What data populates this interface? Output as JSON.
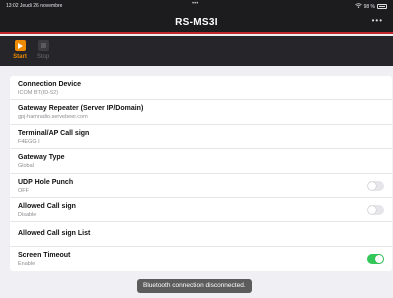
{
  "status_bar": {
    "time_date": "13:02  Jeudi 26 novembre",
    "dots": "•••",
    "battery_text": "98 %"
  },
  "nav": {
    "title": "RS-MS3I",
    "more": "•••"
  },
  "toolbar": {
    "start_label": "Start",
    "stop_label": "Stop"
  },
  "settings": [
    {
      "title": "Connection Device",
      "subtitle": "ICOM BT(ID-52)"
    },
    {
      "title": "Gateway Repeater (Server IP/Domain)",
      "subtitle": "gpj-hamradio.servebeer.com"
    },
    {
      "title": "Terminal/AP Call sign",
      "subtitle": "F4EGG  I"
    },
    {
      "title": "Gateway Type",
      "subtitle": "Global"
    },
    {
      "title": "UDP Hole Punch",
      "subtitle": "OFF",
      "toggle": false
    },
    {
      "title": "Allowed Call sign",
      "subtitle": "Disable",
      "toggle": false
    },
    {
      "title": "Allowed Call sign List"
    },
    {
      "title": "Screen Timeout",
      "subtitle": "Enable",
      "toggle": true
    }
  ],
  "toast": "Bluetooth connection disconnected.",
  "colors": {
    "accent": "#f08a00",
    "nav_border": "#c0272d",
    "toggle_on": "#34c759"
  }
}
